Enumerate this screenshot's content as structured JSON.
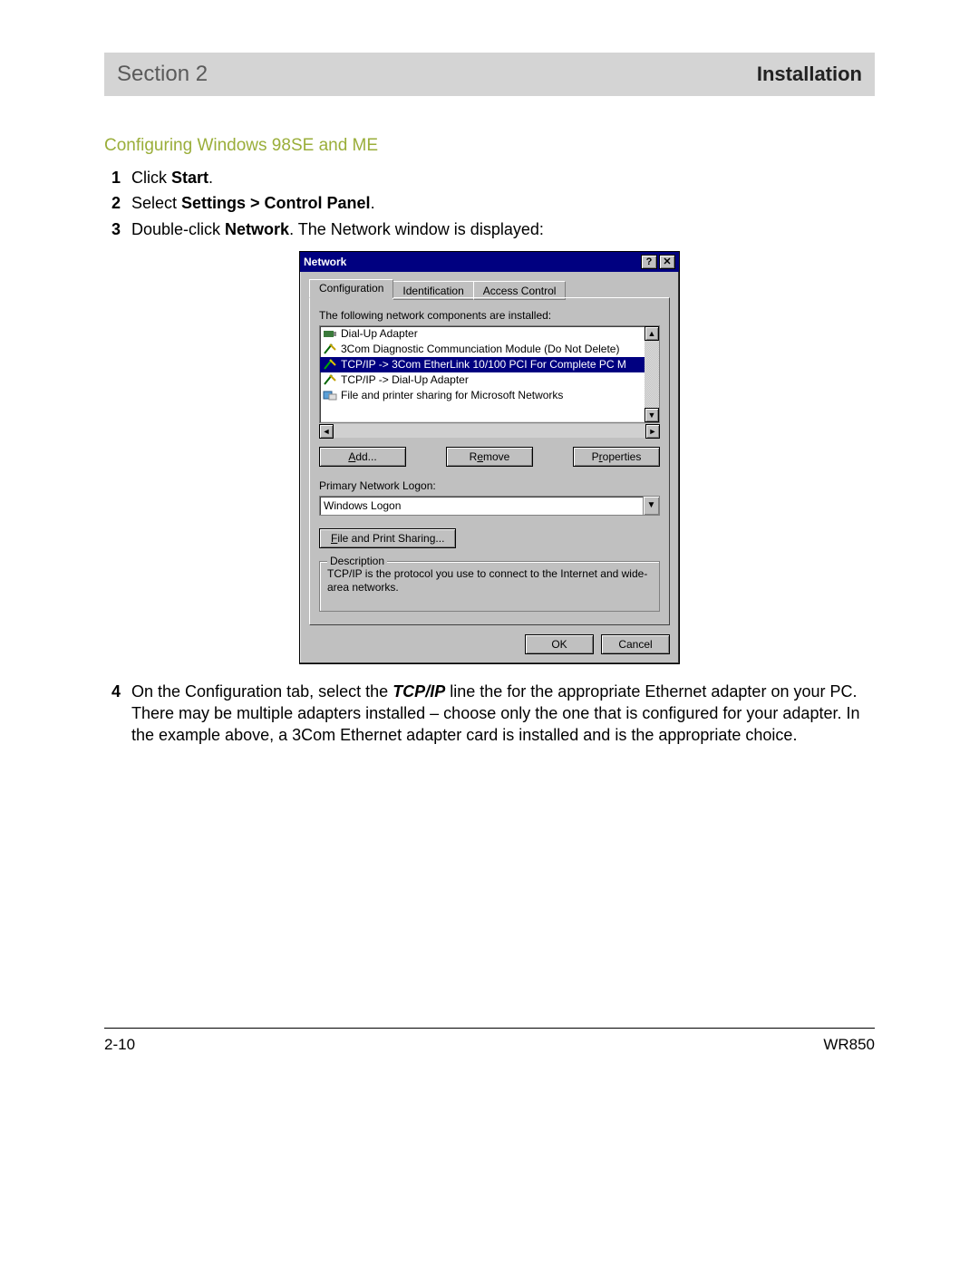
{
  "header": {
    "left": "Section 2",
    "right": "Installation"
  },
  "subheading": "Configuring Windows 98SE and ME",
  "steps": {
    "s1": {
      "num": "1",
      "pre": "Click ",
      "bold": "Start",
      "post": "."
    },
    "s2": {
      "num": "2",
      "pre": "Select ",
      "bold": "Settings > Control Panel",
      "post": "."
    },
    "s3": {
      "num": "3",
      "pre": "Double-click ",
      "bold": "Network",
      "post": ". The Network window is displayed:"
    },
    "s4": {
      "num": "4",
      "pre": "On the Configuration tab, select the ",
      "bi": "TCP/IP",
      "post": " line the for the appropriate Ethernet adapter on your PC. There may be multiple adapters installed – choose only the one that is configured for your adapter. In the example above, a 3Com Ethernet adapter card is installed and is the appropriate choice."
    }
  },
  "dialog": {
    "title": "Network",
    "help_glyph": "?",
    "close_glyph": "✕",
    "tabs": {
      "t1": "Configuration",
      "t2": "Identification",
      "t3": "Access Control"
    },
    "installed_label": "The following network components are installed:",
    "components": {
      "c0": "Dial-Up Adapter",
      "c1": "3Com Diagnostic Communciation Module (Do Not Delete)",
      "c2": "TCP/IP -> 3Com EtherLink 10/100 PCI For Complete PC M",
      "c3": "TCP/IP -> Dial-Up Adapter",
      "c4": "File and printer sharing for Microsoft Networks"
    },
    "buttons": {
      "add": "Add...",
      "remove": "Remove",
      "properties": "Properties"
    },
    "logon_label": "Primary Network Logon:",
    "logon_value": "Windows Logon",
    "share_button": "File and Print Sharing...",
    "description_legend": "Description",
    "description_text": "TCP/IP is the protocol you use to connect to the Internet and wide-area networks.",
    "ok": "OK",
    "cancel": "Cancel"
  },
  "footer": {
    "left": "2-10",
    "right": "WR850"
  }
}
